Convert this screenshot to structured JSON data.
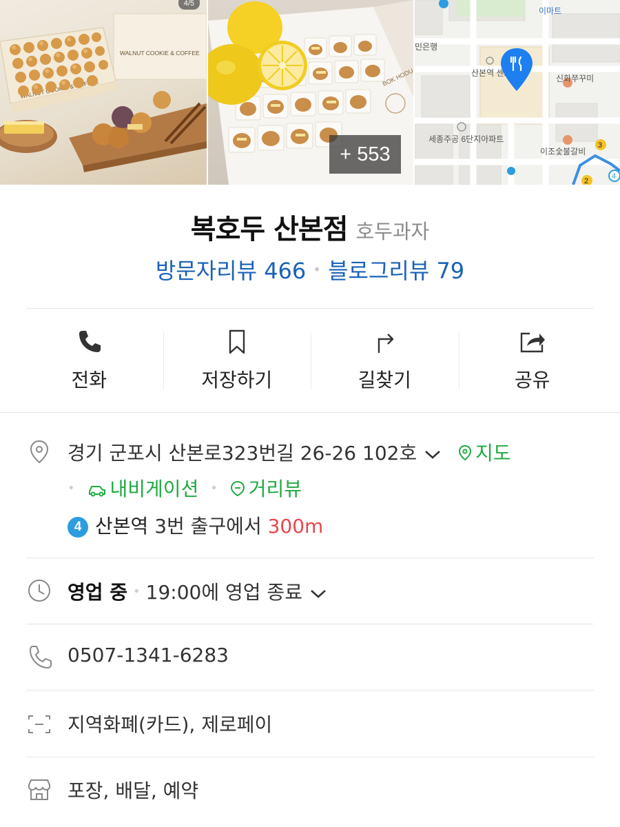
{
  "photos": {
    "counter": "4/5",
    "more_count": "+ 553",
    "photo1_caption": "WALNUT COOKIE & COFFEE",
    "photo2_caption": "BOK HODU",
    "map_labels": {
      "emart": "이마트",
      "bank": "민은행",
      "station_center": "산본역 센트로6",
      "sinhwa": "신화쭈꾸미",
      "sejong": "세종주공 6단지아파트",
      "ijo": "이조숯불갈비",
      "line_num_3": "3",
      "line_num_2": "2",
      "line_num_4": "4"
    }
  },
  "place": {
    "name": "복호두 산본점",
    "category": "호두과자",
    "visitor_reviews": "방문자리뷰 466",
    "blog_reviews": "블로그리뷰 79"
  },
  "actions": [
    {
      "label": "전화",
      "icon": "phone-icon"
    },
    {
      "label": "저장하기",
      "icon": "bookmark-icon"
    },
    {
      "label": "길찾기",
      "icon": "directions-icon"
    },
    {
      "label": "공유",
      "icon": "share-icon"
    }
  ],
  "address": {
    "text": "경기 군포시 산본로323번길 26-26 102호",
    "map_link": "지도",
    "navigation_link": "내비게이션",
    "street_view_link": "거리뷰",
    "subway_line": "4",
    "station": "산본역",
    "exit_text": "3번 출구에서",
    "distance": "300m"
  },
  "hours": {
    "status": "영업 중",
    "detail": "19:00에 영업 종료"
  },
  "phone": {
    "number": "0507-1341-6283"
  },
  "payment": {
    "text": "지역화폐(카드), 제로페이"
  },
  "services": {
    "text": "포장, 배달, 예약"
  },
  "colors": {
    "review_blue": "#1a61b8",
    "link_green": "#1faa41",
    "distance_red": "#e5474c",
    "line4_blue": "#2d9ce0",
    "map_pin_blue": "#1d7ff0"
  }
}
